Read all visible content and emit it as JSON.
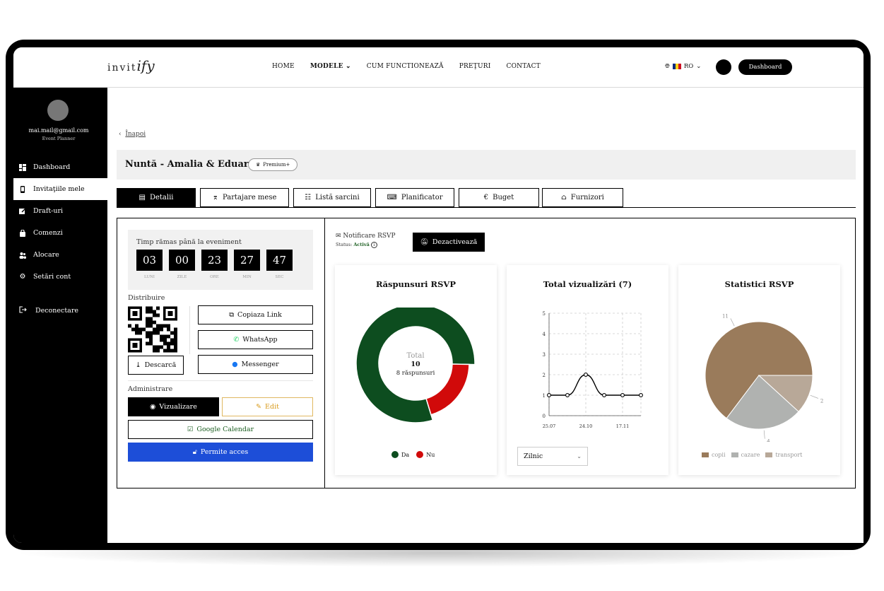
{
  "header": {
    "logo_a": "invit",
    "logo_b": "ify",
    "nav": [
      "HOME",
      "MODELE",
      "CUM FUNCTIONEAZĂ",
      "PREŢURI",
      "CONTACT"
    ],
    "lang": "RO",
    "dashboard_label": "Dashboard",
    "flag_colors": [
      "#002B7F",
      "#FCD116",
      "#CE1126"
    ]
  },
  "sidebar": {
    "email": "mai.mail@gmail.com",
    "role": "Event Planner",
    "items": [
      {
        "label": "Dashboard",
        "icon": "grid-icon"
      },
      {
        "label": "Invitaţiile mele",
        "icon": "phone-icon"
      },
      {
        "label": "Draft-uri",
        "icon": "edit-icon"
      },
      {
        "label": "Comenzi",
        "icon": "bag-icon"
      },
      {
        "label": "Alocare",
        "icon": "users-icon"
      },
      {
        "label": "Setări cont",
        "icon": "gear-icon"
      }
    ],
    "logout": "Deconectare"
  },
  "page": {
    "back": "Înapoi",
    "title": "Nuntă - Amalia & Eduard",
    "premium": "Premium+",
    "tabs": [
      "Detalii",
      "Partajare mese",
      "Listă sarcini",
      "Planificator",
      "Buget",
      "Furnizori"
    ]
  },
  "countdown": {
    "label": "Timp rămas până la eveniment",
    "values": [
      "03",
      "00",
      "23",
      "27",
      "47"
    ],
    "units": [
      "LUNI",
      "ZILE",
      "ORE",
      "MIN",
      "SEC"
    ]
  },
  "distribution": {
    "label": "Distribuire",
    "download": "Descarcă",
    "copy_link": "Copiaza Link",
    "whatsapp": "WhatsApp",
    "messenger": "Messenger"
  },
  "admin": {
    "label": "Administrare",
    "view": "Vizualizare",
    "edit": "Edit",
    "gcal": "Google Calendar",
    "access": "Permite acces"
  },
  "notification": {
    "title": "Notificare RSVP",
    "status_label": "Status:",
    "status_value": "Activă",
    "deactivate": "Dezactivează"
  },
  "cards": {
    "rsvp_title": "Răspunsuri RSVP",
    "views_title": "Total vizualizări (7)",
    "stats_title": "Statistici RSVP",
    "interval": "Zilnic"
  },
  "chart_data": [
    {
      "type": "pie",
      "title": "Răspunsuri RSVP",
      "categories": [
        "Da",
        "Nu"
      ],
      "values": [
        8,
        2
      ],
      "colors": [
        "#0d4d1f",
        "#d10a0a"
      ],
      "center": {
        "label": "Total",
        "total": "10",
        "sub": "8 răspunsuri"
      }
    },
    {
      "type": "line",
      "title": "Total vizualizări (7)",
      "x": [
        "25.07",
        "",
        "24.10",
        "",
        "17.11",
        ""
      ],
      "y": [
        1,
        1,
        2,
        1,
        1,
        1
      ],
      "tick_labels": [
        "25.07",
        "24.10",
        "17.11"
      ],
      "ylim": [
        0,
        5
      ],
      "yticks": [
        0,
        1,
        2,
        3,
        4,
        5
      ],
      "grid": true
    },
    {
      "type": "pie",
      "title": "Statistici RSVP",
      "categories": [
        "copii",
        "cazare",
        "transport"
      ],
      "values": [
        11,
        4,
        2
      ],
      "colors": [
        "#9a7b5b",
        "#b0b2b0",
        "#b8a898"
      ]
    }
  ]
}
